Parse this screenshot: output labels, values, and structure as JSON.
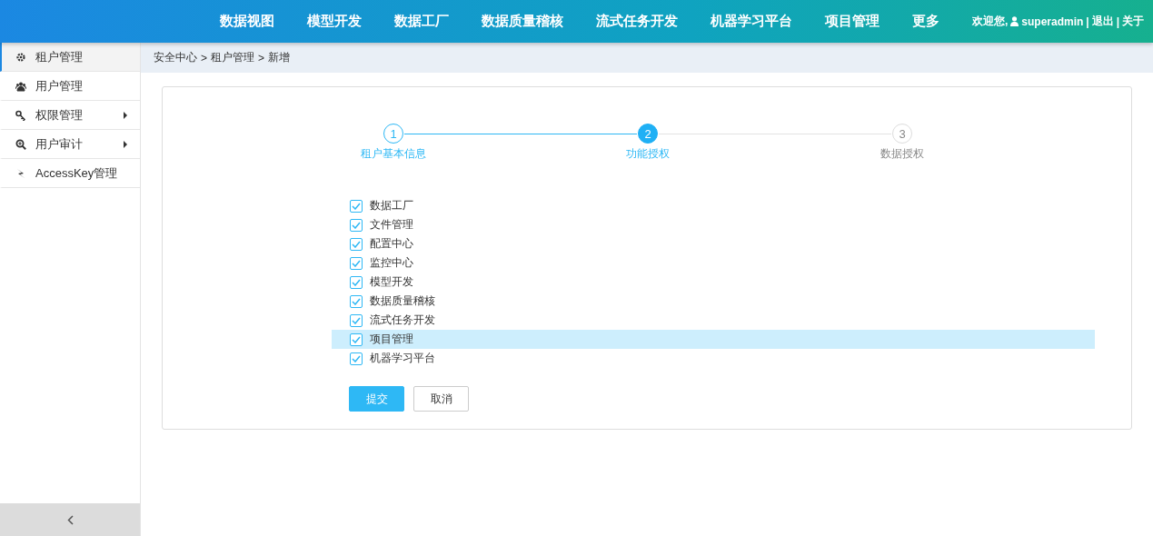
{
  "top_nav": {
    "items": [
      {
        "label": "数据视图"
      },
      {
        "label": "模型开发"
      },
      {
        "label": "数据工厂"
      },
      {
        "label": "数据质量稽核"
      },
      {
        "label": "流式任务开发"
      },
      {
        "label": "机器学习平台"
      },
      {
        "label": "项目管理"
      },
      {
        "label": "更多"
      }
    ],
    "welcome": "欢迎您,",
    "username": "superadmin",
    "separator_1": "|",
    "logout": "退出",
    "separator_2": "|",
    "about": "关于"
  },
  "sidebar": {
    "items": [
      {
        "label": "租户管理",
        "selected": true,
        "has_submenu": false
      },
      {
        "label": "用户管理",
        "selected": false,
        "has_submenu": false
      },
      {
        "label": "权限管理",
        "selected": false,
        "has_submenu": true
      },
      {
        "label": "用户审计",
        "selected": false,
        "has_submenu": true
      },
      {
        "label": "AccessKey管理",
        "selected": false,
        "has_submenu": false
      }
    ]
  },
  "breadcrumb": [
    "安全中心",
    ">",
    "租户管理",
    ">",
    "新增"
  ],
  "steps": [
    {
      "number": "1",
      "label": "租户基本信息",
      "kind": "done"
    },
    {
      "number": "2",
      "label": "功能授权",
      "kind": "active"
    },
    {
      "number": "3",
      "label": "数据授权",
      "kind": "pending"
    }
  ],
  "permissions": [
    {
      "label": "数据工厂",
      "checked": true,
      "selected": false
    },
    {
      "label": "文件管理",
      "checked": true,
      "selected": false
    },
    {
      "label": "配置中心",
      "checked": true,
      "selected": false
    },
    {
      "label": "监控中心",
      "checked": true,
      "selected": false
    },
    {
      "label": "模型开发",
      "checked": true,
      "selected": false
    },
    {
      "label": "数据质量稽核",
      "checked": true,
      "selected": false
    },
    {
      "label": "流式任务开发",
      "checked": true,
      "selected": false
    },
    {
      "label": "项目管理",
      "checked": true,
      "selected": true
    },
    {
      "label": "机器学习平台",
      "checked": true,
      "selected": false
    }
  ],
  "buttons": {
    "submit": "提交",
    "cancel": "取消"
  }
}
